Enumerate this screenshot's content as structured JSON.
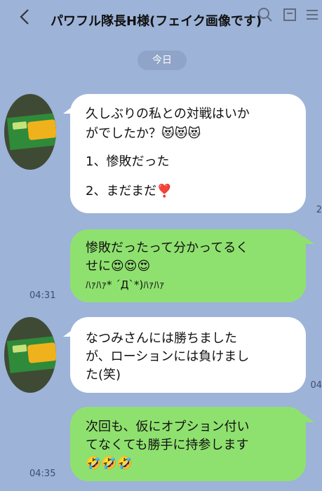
{
  "header": {
    "title": "パワフル隊長H様(フェイク画像です)"
  },
  "date_separator": "今日",
  "messages": [
    {
      "side": "in",
      "lines": [
        "久しぶりの私との対戦はいか",
        "がでしたか？😻😻😻",
        "1、惨敗だった",
        "2、まだまだ❣️"
      ]
    },
    {
      "side": "out",
      "lines": [
        "惨敗だったって分かってるく",
        "せに😍😍😍",
        "ﾊｧﾊｧ* ´Д`*)ﾊｧﾊｧ"
      ],
      "time": "04:31"
    },
    {
      "side": "in",
      "lines": [
        "なつみさんには勝ちました",
        "が、ローションには負けまし",
        "た(笑)"
      ]
    },
    {
      "side": "out",
      "lines": [
        "次回も、仮にオプション付い",
        "てなくても勝手に持参します",
        "🤣🤣🤣"
      ],
      "time": "04:35"
    }
  ],
  "edge_fragments": [
    "04",
    "04"
  ]
}
